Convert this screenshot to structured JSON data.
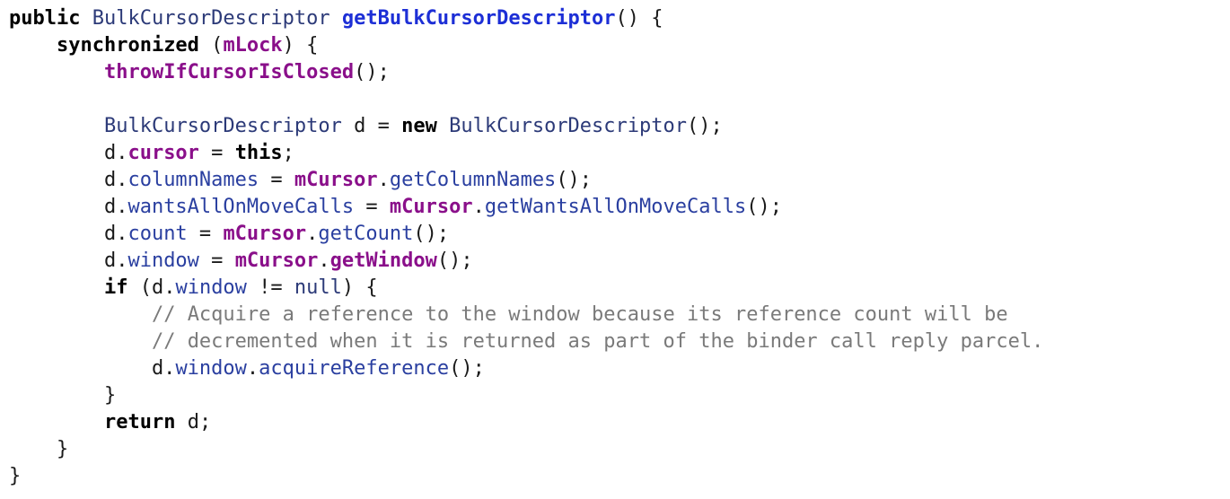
{
  "code": {
    "lines": [
      [
        {
          "t": "public",
          "c": "kw"
        },
        {
          "t": " ",
          "c": "plain"
        },
        {
          "t": "BulkCursorDescriptor",
          "c": "type"
        },
        {
          "t": " ",
          "c": "plain"
        },
        {
          "t": "getBulkCursorDescriptor",
          "c": "fn-decl"
        },
        {
          "t": "() {",
          "c": "punct"
        }
      ],
      [
        {
          "t": "    ",
          "c": "plain"
        },
        {
          "t": "synchronized",
          "c": "kw"
        },
        {
          "t": " (",
          "c": "punct"
        },
        {
          "t": "mLock",
          "c": "mem"
        },
        {
          "t": ") {",
          "c": "punct"
        }
      ],
      [
        {
          "t": "        ",
          "c": "plain"
        },
        {
          "t": "throwIfCursorIsClosed",
          "c": "mem"
        },
        {
          "t": "();",
          "c": "punct"
        }
      ],
      [],
      [
        {
          "t": "        ",
          "c": "plain"
        },
        {
          "t": "BulkCursorDescriptor",
          "c": "type"
        },
        {
          "t": " d = ",
          "c": "plain"
        },
        {
          "t": "new",
          "c": "kw"
        },
        {
          "t": " ",
          "c": "plain"
        },
        {
          "t": "BulkCursorDescriptor",
          "c": "type"
        },
        {
          "t": "();",
          "c": "punct"
        }
      ],
      [
        {
          "t": "        d.",
          "c": "plain"
        },
        {
          "t": "cursor",
          "c": "field-bold"
        },
        {
          "t": " = ",
          "c": "plain"
        },
        {
          "t": "this",
          "c": "kw"
        },
        {
          "t": ";",
          "c": "punct"
        }
      ],
      [
        {
          "t": "        d.",
          "c": "plain"
        },
        {
          "t": "columnNames",
          "c": "field"
        },
        {
          "t": " = ",
          "c": "plain"
        },
        {
          "t": "mCursor",
          "c": "mem"
        },
        {
          "t": ".",
          "c": "punct"
        },
        {
          "t": "getColumnNames",
          "c": "method"
        },
        {
          "t": "();",
          "c": "punct"
        }
      ],
      [
        {
          "t": "        d.",
          "c": "plain"
        },
        {
          "t": "wantsAllOnMoveCalls",
          "c": "field"
        },
        {
          "t": " = ",
          "c": "plain"
        },
        {
          "t": "mCursor",
          "c": "mem"
        },
        {
          "t": ".",
          "c": "punct"
        },
        {
          "t": "getWantsAllOnMoveCalls",
          "c": "method"
        },
        {
          "t": "();",
          "c": "punct"
        }
      ],
      [
        {
          "t": "        d.",
          "c": "plain"
        },
        {
          "t": "count",
          "c": "field"
        },
        {
          "t": " = ",
          "c": "plain"
        },
        {
          "t": "mCursor",
          "c": "mem"
        },
        {
          "t": ".",
          "c": "punct"
        },
        {
          "t": "getCount",
          "c": "method"
        },
        {
          "t": "();",
          "c": "punct"
        }
      ],
      [
        {
          "t": "        d.",
          "c": "plain"
        },
        {
          "t": "window",
          "c": "field"
        },
        {
          "t": " = ",
          "c": "plain"
        },
        {
          "t": "mCursor",
          "c": "mem"
        },
        {
          "t": ".",
          "c": "punct"
        },
        {
          "t": "getWindow",
          "c": "mem"
        },
        {
          "t": "();",
          "c": "punct"
        }
      ],
      [
        {
          "t": "        ",
          "c": "plain"
        },
        {
          "t": "if",
          "c": "kw"
        },
        {
          "t": " (d.",
          "c": "plain"
        },
        {
          "t": "window",
          "c": "field"
        },
        {
          "t": " != ",
          "c": "plain"
        },
        {
          "t": "null",
          "c": "lit"
        },
        {
          "t": ") {",
          "c": "punct"
        }
      ],
      [
        {
          "t": "            ",
          "c": "plain"
        },
        {
          "t": "// Acquire a reference to the window because its reference count will be",
          "c": "comment"
        }
      ],
      [
        {
          "t": "            ",
          "c": "plain"
        },
        {
          "t": "// decremented when it is returned as part of the binder call reply parcel.",
          "c": "comment"
        }
      ],
      [
        {
          "t": "            d.",
          "c": "plain"
        },
        {
          "t": "window",
          "c": "field"
        },
        {
          "t": ".",
          "c": "punct"
        },
        {
          "t": "acquireReference",
          "c": "method"
        },
        {
          "t": "();",
          "c": "punct"
        }
      ],
      [
        {
          "t": "        }",
          "c": "punct"
        }
      ],
      [
        {
          "t": "        ",
          "c": "plain"
        },
        {
          "t": "return",
          "c": "kw"
        },
        {
          "t": " d;",
          "c": "plain"
        }
      ],
      [
        {
          "t": "    }",
          "c": "punct"
        }
      ],
      [
        {
          "t": "}",
          "c": "punct"
        }
      ]
    ]
  }
}
